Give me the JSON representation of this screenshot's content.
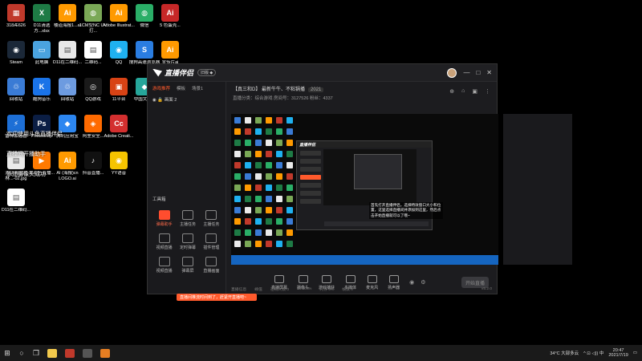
{
  "desktop": {
    "icons": [
      {
        "label": "318Æ626",
        "color": "#c0392b",
        "glyph": "▦"
      },
      {
        "label": "Steam",
        "color": "#1b2838",
        "glyph": "◉"
      },
      {
        "label": "回收站",
        "color": "#3a7bd5",
        "glyph": "♲"
      },
      {
        "label": "雷神加速器",
        "color": "#1d6fd6",
        "glyph": "⚡"
      },
      {
        "label": "浙江禹采园林...-02.jpg",
        "color": "#eaeaea",
        "glyph": "▤"
      },
      {
        "label": "D11在二维码...",
        "color": "#ffffff",
        "glyph": "▤"
      },
      {
        "label": "D11清选方...xlsx",
        "color": "#1e7b45",
        "glyph": "X"
      },
      {
        "label": "此电脑",
        "color": "#4aa3df",
        "glyph": "▭"
      },
      {
        "label": "酷狗音乐",
        "color": "#1a73e8",
        "glyph": "K"
      },
      {
        "label": "Photoshop",
        "color": "#0b1e44",
        "glyph": "Ps"
      },
      {
        "label": "爱奇艺直播...",
        "color": "#ff7a00",
        "glyph": "▶"
      },
      {
        "label": "楼道海报1...ai",
        "color": "#ff9a00",
        "glyph": "Ai"
      },
      {
        "label": "D11在二维码...",
        "color": "#e8e8e8",
        "glyph": "▤"
      },
      {
        "label": "回收站",
        "color": "#6d9be0",
        "glyph": "♲"
      },
      {
        "label": "腾讯应用宝",
        "color": "#2c86f0",
        "glyph": "◆"
      },
      {
        "label": "AI (海报)cn LOGO.ai",
        "color": "#ff9a00",
        "glyph": "Ai"
      },
      {
        "label": "1CM型NC UV打...",
        "color": "#7aa856",
        "glyph": "◍"
      },
      {
        "label": "二维码...",
        "color": "#ffffff",
        "glyph": "▤"
      },
      {
        "label": "QQ游戏",
        "color": "#1a1a1a",
        "glyph": "◎"
      },
      {
        "label": "阿里安全...",
        "color": "#ff6a00",
        "glyph": "◈"
      },
      {
        "label": "抖音直播...",
        "color": "#111111",
        "glyph": "♪"
      },
      {
        "label": "Adobe Illustrat...",
        "color": "#ff9a00",
        "glyph": "Ai"
      },
      {
        "label": "QQ",
        "color": "#1fb1f0",
        "glyph": "◉"
      },
      {
        "label": "11平台",
        "color": "#d84315",
        "glyph": "▣"
      },
      {
        "label": "Adobe Creati...",
        "color": "#d32f2f",
        "glyph": "Cc"
      },
      {
        "label": "YY语音",
        "color": "#f5c400",
        "glyph": "◉"
      },
      {
        "label": "微信",
        "color": "#2aae67",
        "glyph": "◍"
      },
      {
        "label": "搜狗高速浏览器",
        "color": "#2a7de1",
        "glyph": "S"
      },
      {
        "label": "中国文公...",
        "color": "#26a69a",
        "glyph": "◆"
      },
      {
        "label": "5 色蛋壳...",
        "color": "#c62828",
        "glyph": "Ai"
      },
      {
        "label": "宣传片ai",
        "color": "#ff9a00",
        "glyph": "Ai"
      },
      {
        "label": "公司宣传册",
        "color": "#ff9a00",
        "glyph": "Ai"
      }
    ],
    "overlay_lines": [
      "欢迎使用斗鱼直播伴侣",
      "直播间开播助手",
      "添加摄像头成功"
    ]
  },
  "app": {
    "title": "直播伴侣",
    "version_badge": "旧版 ◆",
    "window_controls": [
      "—",
      "□",
      "✕"
    ],
    "left_tabs": [
      "游戏推荐",
      "模板",
      "场景1"
    ],
    "scene_item": "画面 2",
    "tools_title": "工具箱",
    "tools": [
      {
        "label": "弹幕助手",
        "hot": true
      },
      {
        "label": "主播任务",
        "hot": false
      },
      {
        "label": "主播任务",
        "hot": false
      },
      {
        "label": "视频直播",
        "hot": false
      },
      {
        "label": "定时弹幕",
        "hot": false
      },
      {
        "label": "插件管理",
        "hot": false
      },
      {
        "label": "视频直播",
        "hot": false
      },
      {
        "label": "弹幕屏",
        "hot": false
      },
      {
        "label": "直播画面",
        "hot": false
      }
    ],
    "toast": "直播间推流时间到了，赶紧开直播吧~",
    "room": {
      "title": "【真三和D】 最新牛牛、不粘锅播",
      "tag": "2021",
      "line2": "直播分类：综合游戏    房间号：3127526    粉丝：4337"
    },
    "head_icons": [
      "⊕",
      "⌂",
      "▣",
      "⋮"
    ],
    "caption": "首先打开直播伴侣，选择特效窗口大小和位置，这里选择直播间并添加到这里，然后点击开始直播就可以了哦~",
    "bottom_tools": [
      "直播屏幕",
      "摄像头",
      "游戏捕获",
      "多媒体",
      "麦克风",
      "扬声器"
    ],
    "live_button": "开始直播",
    "status": [
      "直播信息",
      "峰值",
      "在线人数 0",
      "CPU 0%",
      "内存 0%",
      "帧数 0"
    ],
    "version": "v5.2.0"
  },
  "taskbar": {
    "start": "⊞",
    "search": "○",
    "taskview": "❐",
    "apps": [
      {
        "name": "file-explorer",
        "color": "#f2c94c"
      },
      {
        "name": "browser",
        "color": "#c0392b"
      },
      {
        "name": "app-a",
        "color": "#555"
      },
      {
        "name": "app-b",
        "color": "#e67e22"
      }
    ],
    "weather": "34°C 大部多云",
    "tray_icons": "^ ⊡ ◁)) 中",
    "time": "20:47",
    "date": "2021/7/19"
  }
}
